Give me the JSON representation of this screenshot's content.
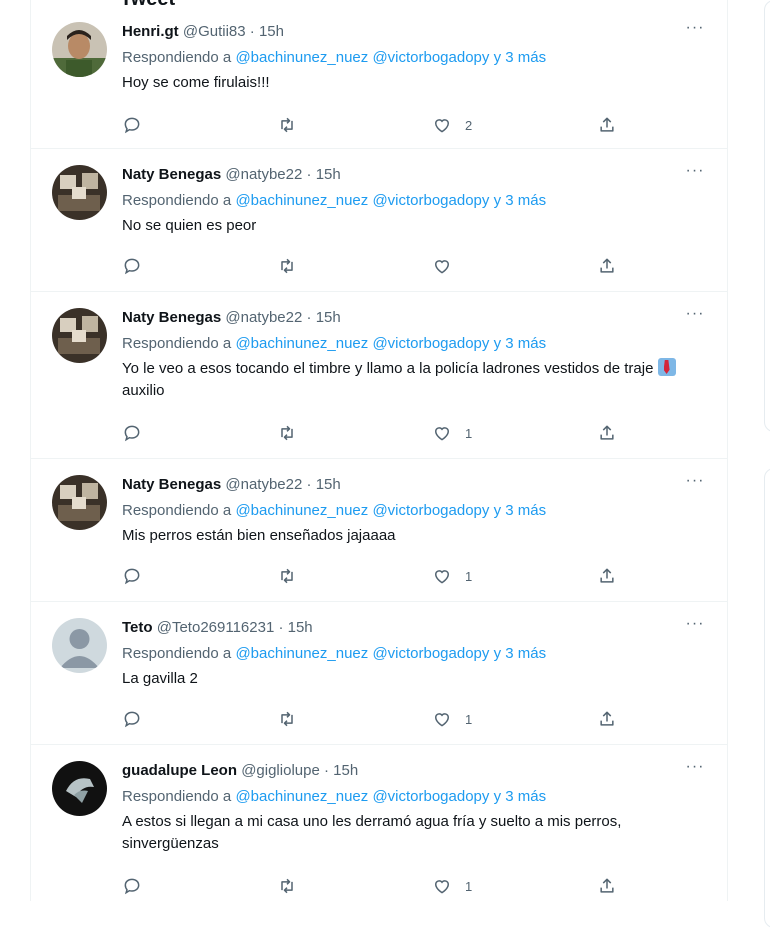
{
  "header": {
    "title": "Tweet"
  },
  "tweets": [
    {
      "name": "Henri.gt",
      "handle": "@Gutii83",
      "time": "15h",
      "reply_prefix": "Respondiendo a",
      "mention_1": "@bachinunez_nuez",
      "mention_2": "@victorbogadopy",
      "mention_more": "y 3 más",
      "text": "Hoy se come firulais!!!",
      "text_after_emoji": "",
      "likes": "2",
      "avatar": "photo-man"
    },
    {
      "name": "Naty Benegas",
      "handle": "@natybe22",
      "time": "15h",
      "reply_prefix": "Respondiendo a",
      "mention_1": "@bachinunez_nuez",
      "mention_2": "@victorbogadopy",
      "mention_more": "y 3 más",
      "text": "No se quien es peor",
      "text_after_emoji": "",
      "likes": "",
      "avatar": "photo-dark"
    },
    {
      "name": "Naty Benegas",
      "handle": "@natybe22",
      "time": "15h",
      "reply_prefix": "Respondiendo a",
      "mention_1": "@bachinunez_nuez",
      "mention_2": "@victorbogadopy",
      "mention_more": "y 3 más",
      "text": "Yo le veo a esos tocando el timbre y llamo a la policía ladrones vestidos de traje",
      "text_after_emoji": "auxilio",
      "likes": "1",
      "avatar": "photo-dark"
    },
    {
      "name": "Naty Benegas",
      "handle": "@natybe22",
      "time": "15h",
      "reply_prefix": "Respondiendo a",
      "mention_1": "@bachinunez_nuez",
      "mention_2": "@victorbogadopy",
      "mention_more": "y 3 más",
      "text": "Mis perros están bien enseñados jajaaaa",
      "text_after_emoji": "",
      "likes": "1",
      "avatar": "photo-dark"
    },
    {
      "name": "Teto",
      "handle": "@Teto269116231",
      "time": "15h",
      "reply_prefix": "Respondiendo a",
      "mention_1": "@bachinunez_nuez",
      "mention_2": "@victorbogadopy",
      "mention_more": "y 3 más",
      "text": "La gavilla 2",
      "text_after_emoji": "",
      "likes": "1",
      "avatar": "default-avatar"
    },
    {
      "name": "guadalupe Leon",
      "handle": "@gigliolupe",
      "time": "15h",
      "reply_prefix": "Respondiendo a",
      "mention_1": "@bachinunez_nuez",
      "mention_2": "@victorbogadopy",
      "mention_more": "y 3 más",
      "text": "A estos si llegan a mi casa uno les derramó agua fría y suelto a mis perros, sinvergüenzas",
      "text_after_emoji": "",
      "likes": "1",
      "avatar": "photo-black"
    }
  ],
  "ui": {
    "dot": "·",
    "more": "···"
  },
  "colors": {
    "link": "#1d9bf0",
    "muted": "#536471",
    "text": "#0f1419",
    "border": "#eff3f4"
  },
  "icons": [
    "reply-icon",
    "retweet-icon",
    "like-icon",
    "share-icon",
    "more-icon"
  ]
}
